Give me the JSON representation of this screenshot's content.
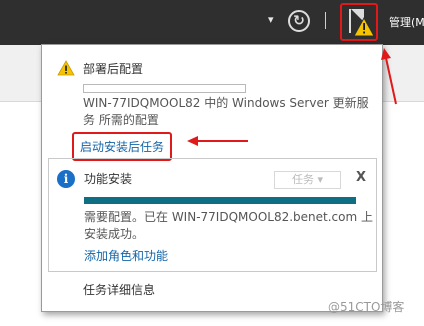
{
  "toolbar": {
    "dropdown_caret": "▾",
    "refresh_icon": "refresh-icon",
    "flag_icon": "flag-warning-icon",
    "manage_label": "管理(M"
  },
  "notifications": {
    "post_deploy": {
      "title": "部署后配置",
      "message": "WIN-77IDQMOOL82 中的 Windows Server 更新服务 所需的配置",
      "link": "启动安装后任务"
    },
    "feature_install": {
      "title": "功能安装",
      "task_dropdown": "任务",
      "close": "X",
      "progress_percent": 100,
      "message": "需要配置。已在 WIN-77IDQMOOL82.benet.com 上安装成功。",
      "link": "添加角色和功能"
    },
    "details_link": "任务详细信息"
  },
  "watermark": "@51CTO博客",
  "colors": {
    "toolbar_bg": "#2f2f2f",
    "highlight": "#e01a1a",
    "link": "#1565a8",
    "progress": "#0d6e84",
    "info": "#1a6fc7",
    "warning": "#f5c400"
  }
}
